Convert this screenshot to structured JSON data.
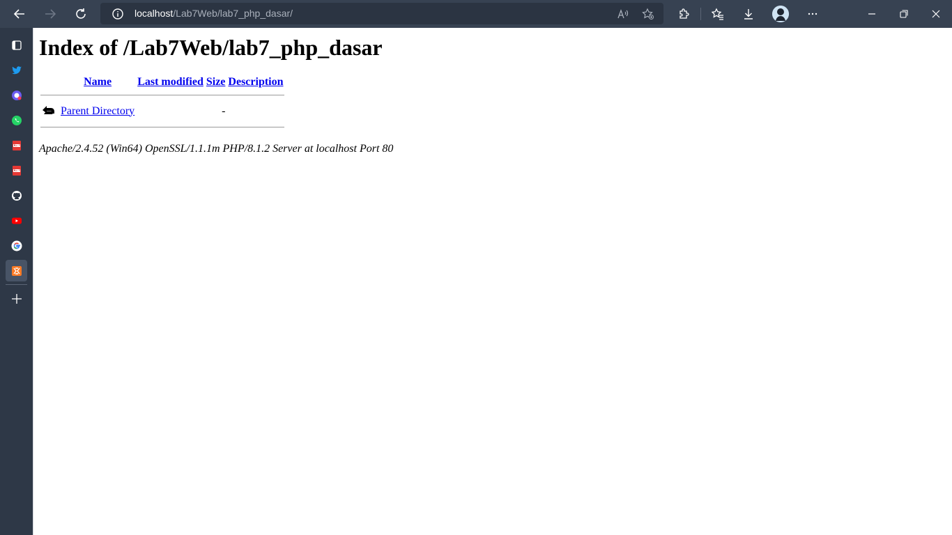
{
  "browser": {
    "address_host": "localhost",
    "address_path": "/Lab7Web/lab7_php_dasar/",
    "icons": {
      "back": "back-arrow-icon",
      "forward": "forward-arrow-icon",
      "refresh": "refresh-icon",
      "info": "info-icon",
      "read_aloud": "read-aloud-icon",
      "add_favorite": "add-favorite-icon",
      "extensions": "extensions-icon",
      "favorites": "favorites-icon",
      "downloads": "download-icon",
      "more": "more-icon",
      "minimize": "minimize-icon",
      "restore": "restore-icon",
      "close": "close-icon"
    },
    "colors": {
      "topbar": "#374252",
      "sidebar": "#2e3847",
      "link": "#0000ee"
    }
  },
  "sidebar": {
    "items": [
      {
        "icon": "tabs-icon"
      },
      {
        "icon": "twitter-icon"
      },
      {
        "icon": "messenger-icon"
      },
      {
        "icon": "whatsapp-icon"
      },
      {
        "icon": "pdf-icon"
      },
      {
        "icon": "pdf-icon"
      },
      {
        "icon": "github-icon"
      },
      {
        "icon": "youtube-icon"
      },
      {
        "icon": "google-icon"
      },
      {
        "icon": "xampp-icon"
      },
      {
        "icon": "add-icon"
      }
    ]
  },
  "page": {
    "title": "Index of /Lab7Web/lab7_php_dasar",
    "columns": {
      "name": "Name",
      "last_modified": "Last modified",
      "size": "Size",
      "description": "Description"
    },
    "rows": [
      {
        "name": "Parent Directory",
        "last_modified": "",
        "size": "-",
        "description": ""
      }
    ],
    "footer": "Apache/2.4.52 (Win64) OpenSSL/1.1.1m PHP/8.1.2 Server at localhost Port 80"
  }
}
